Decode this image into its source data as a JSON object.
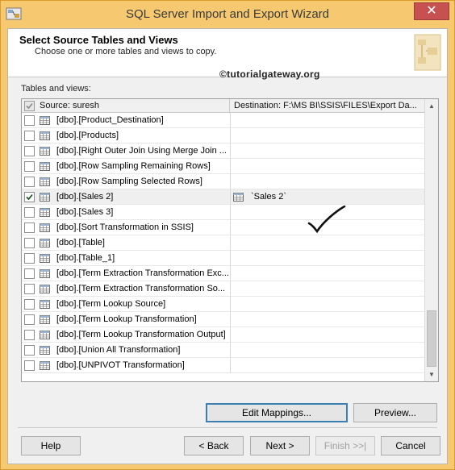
{
  "window": {
    "title": "SQL Server Import and Export Wizard",
    "close_symbol": "✕"
  },
  "header": {
    "title": "Select Source Tables and Views",
    "subtitle": "Choose one or more tables and views to copy.",
    "watermark": "©tutorialgateway.org"
  },
  "grid": {
    "label": "Tables and views:",
    "source_header": "Source: suresh",
    "destination_header": "Destination: F:\\MS BI\\SSIS\\FILES\\Export Da...",
    "rows": [
      {
        "source": "[dbo].[Product_Destination]",
        "destination": "",
        "checked": false
      },
      {
        "source": "[dbo].[Products]",
        "destination": "",
        "checked": false
      },
      {
        "source": "[dbo].[Right Outer Join Using Merge Join ...",
        "destination": "",
        "checked": false
      },
      {
        "source": "[dbo].[Row Sampling Remaining Rows]",
        "destination": "",
        "checked": false
      },
      {
        "source": "[dbo].[Row Sampling Selected Rows]",
        "destination": "",
        "checked": false
      },
      {
        "source": "[dbo].[Sales 2]",
        "destination": "`Sales 2`",
        "checked": true
      },
      {
        "source": "[dbo].[Sales 3]",
        "destination": "",
        "checked": false
      },
      {
        "source": "[dbo].[Sort Transformation in SSIS]",
        "destination": "",
        "checked": false
      },
      {
        "source": "[dbo].[Table]",
        "destination": "",
        "checked": false
      },
      {
        "source": "[dbo].[Table_1]",
        "destination": "",
        "checked": false
      },
      {
        "source": "[dbo].[Term Extraction Transformation Exc...",
        "destination": "",
        "checked": false
      },
      {
        "source": "[dbo].[Term Extraction Transformation So...",
        "destination": "",
        "checked": false
      },
      {
        "source": "[dbo].[Term Lookup Source]",
        "destination": "",
        "checked": false
      },
      {
        "source": "[dbo].[Term Lookup Transformation]",
        "destination": "",
        "checked": false
      },
      {
        "source": "[dbo].[Term Lookup Transformation Output]",
        "destination": "",
        "checked": false
      },
      {
        "source": "[dbo].[Union All Transformation]",
        "destination": "",
        "checked": false
      },
      {
        "source": "[dbo].[UNPIVOT Transformation]",
        "destination": "",
        "checked": false
      }
    ]
  },
  "buttons": {
    "edit_mappings": "Edit Mappings...",
    "preview": "Preview...",
    "help": "Help",
    "back": "< Back",
    "next": "Next >",
    "finish": "Finish >>|",
    "cancel": "Cancel"
  },
  "colors": {
    "title_bar": "#f6c86f",
    "close_button": "#c75050",
    "focus_border": "#3c7fb1"
  }
}
